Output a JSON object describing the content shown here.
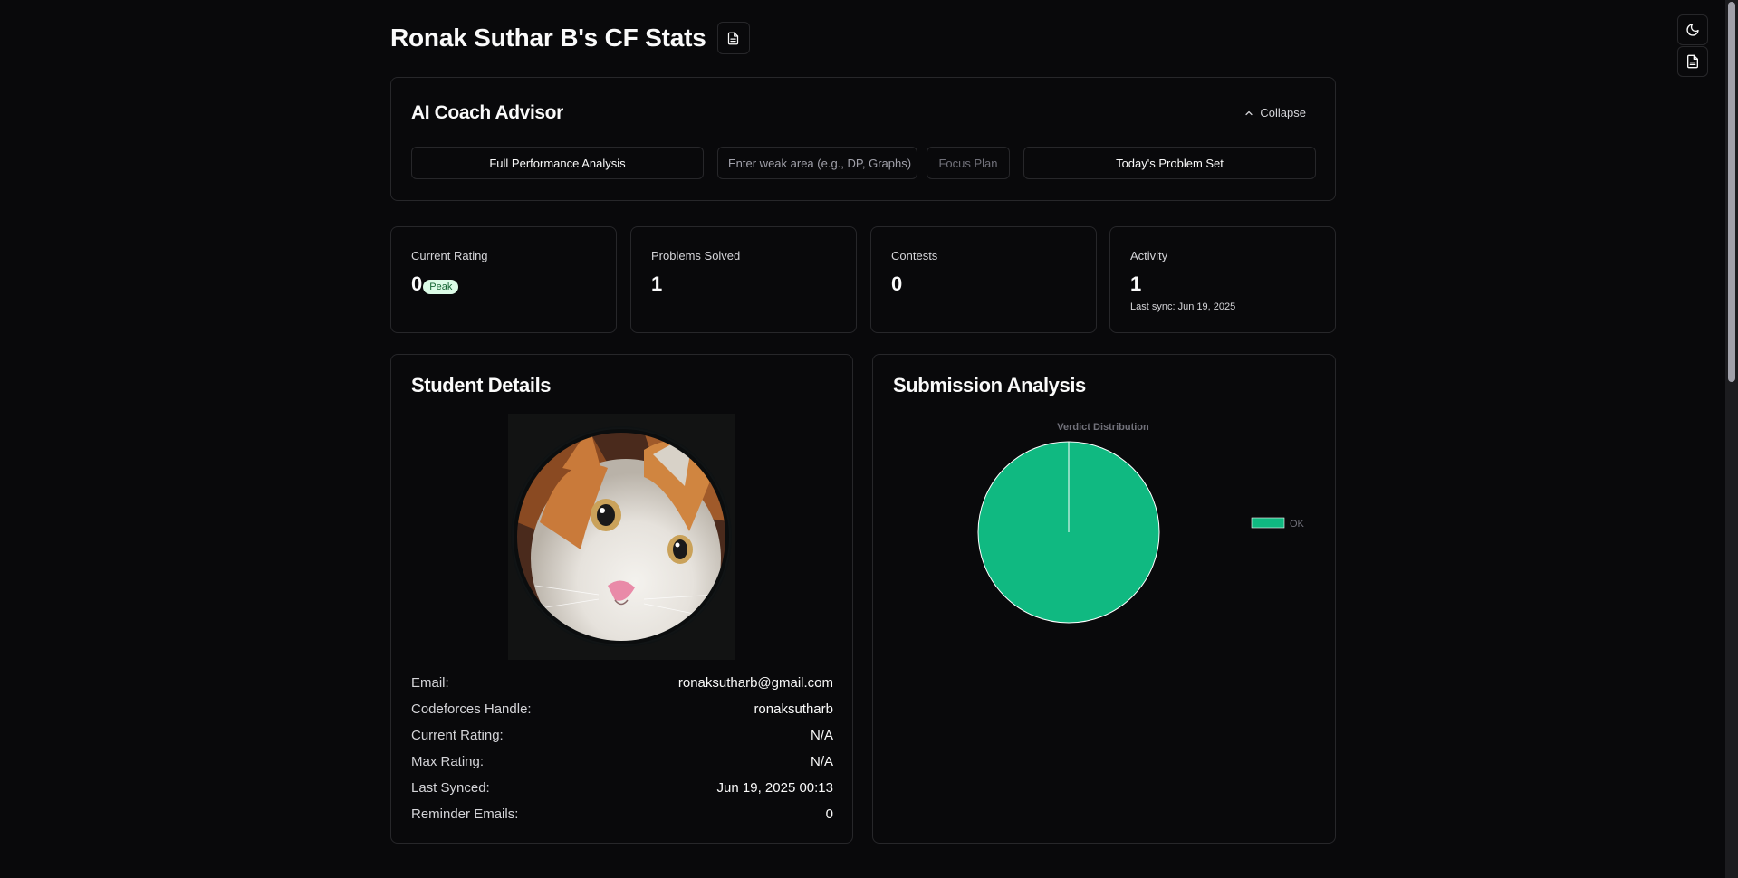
{
  "header": {
    "title": "Ronak Suthar B's CF Stats"
  },
  "coach": {
    "title": "AI Coach Advisor",
    "collapse_label": "Collapse",
    "full_analysis_label": "Full Performance Analysis",
    "weak_area_placeholder": "Enter weak area (e.g., DP, Graphs)",
    "focus_plan_label": "Focus Plan",
    "problem_set_label": "Today's Problem Set"
  },
  "stats": [
    {
      "label": "Current Rating",
      "value": "0",
      "badge": "Peak"
    },
    {
      "label": "Problems Solved",
      "value": "1"
    },
    {
      "label": "Contests",
      "value": "0"
    },
    {
      "label": "Activity",
      "value": "1",
      "sub": "Last sync: Jun 19, 2025"
    }
  ],
  "student": {
    "title": "Student Details",
    "fields": [
      {
        "key": "Email:",
        "value": "ronaksutharb@gmail.com"
      },
      {
        "key": "Codeforces Handle:",
        "value": "ronaksutharb"
      },
      {
        "key": "Current Rating:",
        "value": "N/A"
      },
      {
        "key": "Max Rating:",
        "value": "N/A"
      },
      {
        "key": "Last Synced:",
        "value": "Jun 19, 2025 00:13"
      },
      {
        "key": "Reminder Emails:",
        "value": "0"
      }
    ]
  },
  "submission": {
    "title": "Submission Analysis"
  },
  "colors": {
    "ok": "#10b981",
    "background": "#09090b",
    "border": "#27272a"
  },
  "chart_data": {
    "type": "pie",
    "title": "Verdict Distribution",
    "categories": [
      "OK"
    ],
    "values": [
      1
    ],
    "legend": "right"
  }
}
